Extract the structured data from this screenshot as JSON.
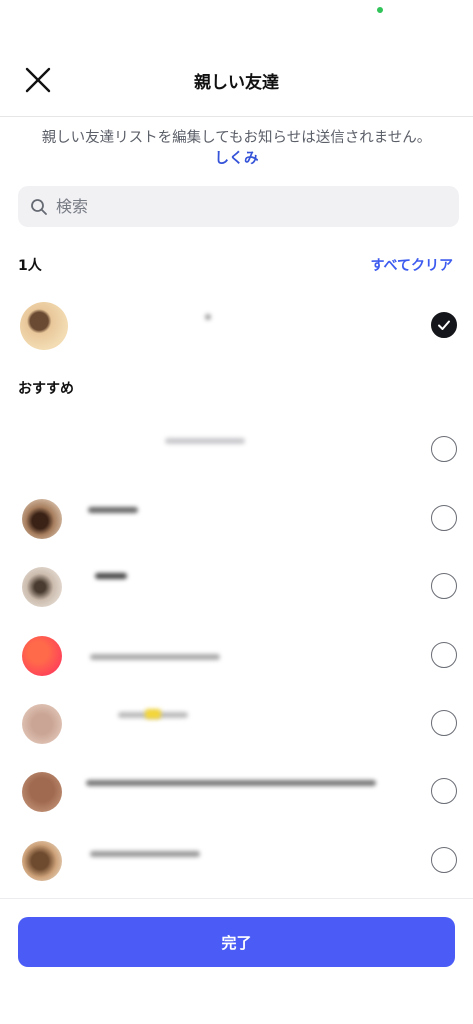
{
  "header": {
    "title": "親しい友達",
    "close_icon": "close-icon"
  },
  "notice": {
    "text": "親しい友達リストを編集してもお知らせは送信されません。",
    "link": "しくみ"
  },
  "search": {
    "placeholder": "検索",
    "value": ""
  },
  "selected_section": {
    "count_label": "1人",
    "clear_label": "すべてクリア"
  },
  "recommended_section": {
    "label": "おすすめ"
  },
  "footer": {
    "done_label": "完了"
  },
  "colors": {
    "accent": "#4a5cf5",
    "link": "#3553d8",
    "checked": "#14161b"
  }
}
